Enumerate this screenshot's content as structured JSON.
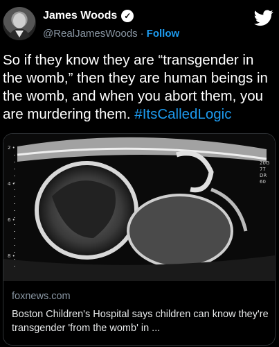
{
  "author": {
    "name": "James Woods",
    "handle": "@RealJamesWoods",
    "separator": "·",
    "follow_label": "Follow",
    "verified": true
  },
  "tweet": {
    "text": "So if they know they are “transgender in the womb,” then they are human beings in the womb, and when you abort them, you are murdering them.",
    "hashtag": "#ItsCalledLogic"
  },
  "link_card": {
    "domain": "foxnews.com",
    "title": "Boston Children's Hospital says children can know they're transgender 'from the womb' in ..."
  },
  "ultrasound_scale": [
    "2",
    "4",
    "6",
    "8"
  ],
  "ultrasound_side": [
    "20G",
    "77",
    "DR",
    "60"
  ],
  "icons": {
    "platform": "twitter-bird-icon",
    "verified": "verified-badge-icon"
  },
  "colors": {
    "accent": "#1d9bf0",
    "muted": "#8b98a5",
    "background": "#000000"
  }
}
